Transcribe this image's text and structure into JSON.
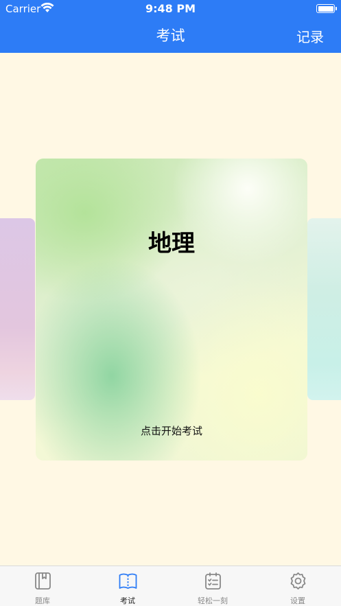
{
  "status_bar": {
    "carrier": "Carrier",
    "time": "9:48 PM"
  },
  "nav": {
    "title": "考试",
    "right_action": "记录",
    "background": "#2d7cf6"
  },
  "card": {
    "title": "地理",
    "hint": "点击开始考试"
  },
  "tabbar": {
    "items": [
      {
        "label": "题库",
        "icon": "book-icon",
        "active": false
      },
      {
        "label": "考试",
        "icon": "open-book-icon",
        "active": true
      },
      {
        "label": "轻松一刻",
        "icon": "calendar-checklist-icon",
        "active": false
      },
      {
        "label": "设置",
        "icon": "gear-icon",
        "active": false
      }
    ],
    "active_color": "#2d7cf6",
    "inactive_color": "#888888"
  },
  "colors": {
    "page_background": "#fff8e4"
  }
}
